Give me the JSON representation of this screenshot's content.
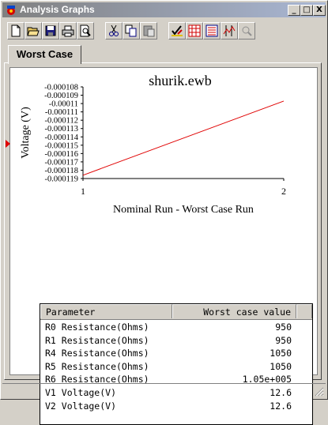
{
  "window": {
    "title": "Analysis Graphs",
    "controls": {
      "minimize": "_",
      "maximize": "□",
      "close": "X"
    }
  },
  "toolbar": {
    "buttons": [
      "new-icon",
      "open-icon",
      "save-icon",
      "print-icon",
      "print-preview-icon",
      "cut-icon",
      "copy-icon",
      "paste-icon",
      "properties-icon",
      "grid-icon",
      "legend-icon",
      "cursors-icon",
      "zoom-icon"
    ]
  },
  "tabs": [
    {
      "label": "Worst Case"
    }
  ],
  "chart_data": {
    "type": "line",
    "title": "shurik.ewb",
    "xlabel": "Nominal Run - Worst Case Run",
    "ylabel": "Voltage (V)",
    "x_ticks": [
      "1",
      "2"
    ],
    "y_ticks": [
      "-0.000108",
      "-0.000109",
      "-0.00011",
      "-0.000111",
      "-0.000112",
      "-0.000113",
      "-0.000114",
      "-0.000115",
      "-0.000116",
      "-0.000117",
      "-0.000118",
      "-0.000119"
    ],
    "xlim": [
      1,
      2
    ],
    "ylim": [
      -0.000119,
      -0.000108
    ],
    "series": [
      {
        "color": "#e00000",
        "x": [
          1,
          2
        ],
        "y": [
          -0.0001186,
          -0.0001097
        ]
      }
    ]
  },
  "marker_color": "#e00000",
  "table": {
    "headers": [
      "Parameter",
      "Worst case value"
    ],
    "rows": [
      [
        "R0 Resistance(Ohms)",
        "950"
      ],
      [
        "R1 Resistance(Ohms)",
        "950"
      ],
      [
        "R4 Resistance(Ohms)",
        "1050"
      ],
      [
        "R5 Resistance(Ohms)",
        "1050"
      ],
      [
        "R6 Resistance(Ohms)",
        "1.05e+005"
      ],
      [
        "V1 Voltage(V)",
        "12.6"
      ],
      [
        "V2 Voltage(V)",
        "12.6"
      ]
    ]
  }
}
